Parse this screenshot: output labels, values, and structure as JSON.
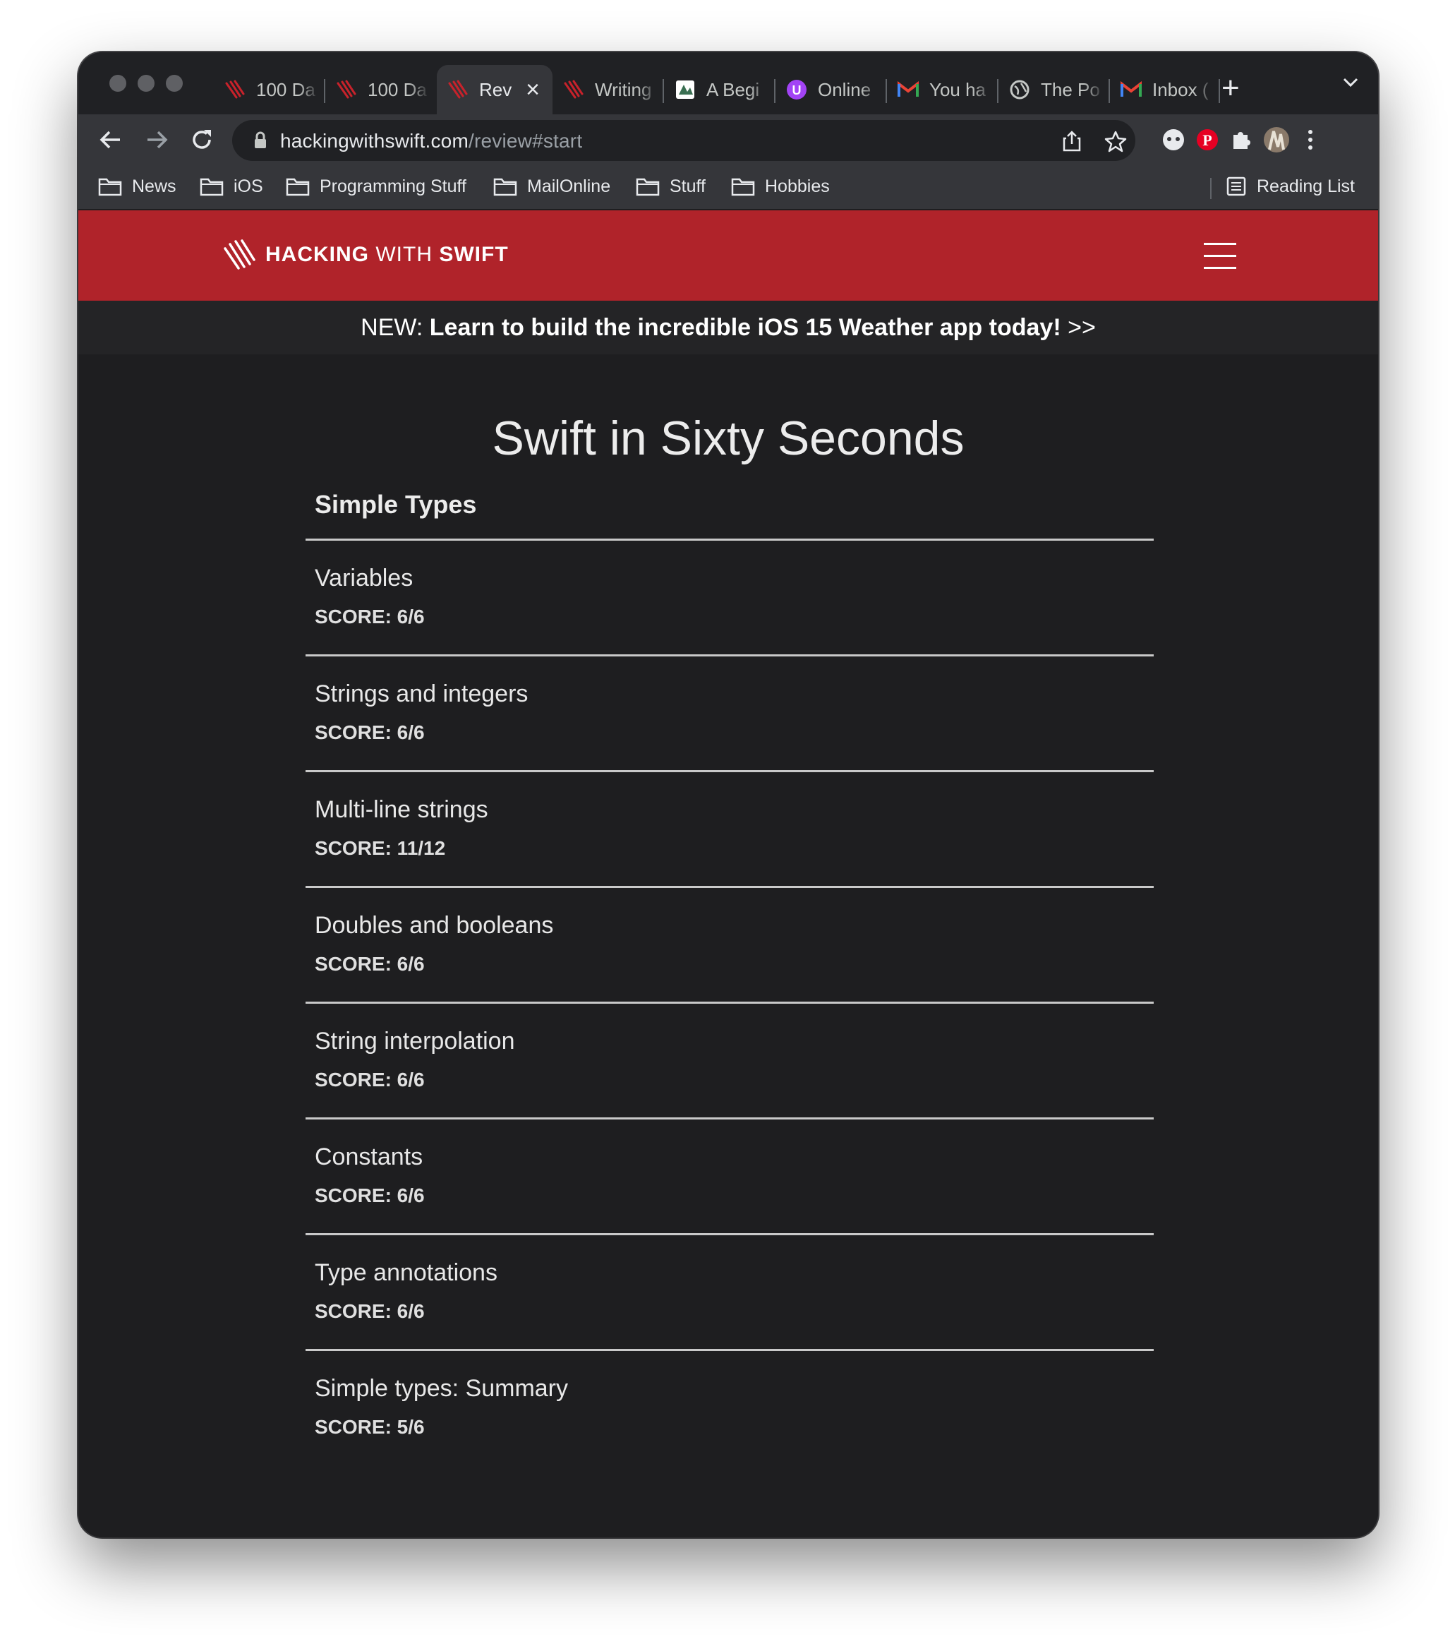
{
  "browser": {
    "tabs": [
      {
        "title": "100 Da",
        "icon": "hws-favicon"
      },
      {
        "title": "100 Da",
        "icon": "hws-favicon"
      },
      {
        "title": "Rev",
        "icon": "hws-favicon",
        "active": true
      },
      {
        "title": "Writing",
        "icon": "hws-favicon"
      },
      {
        "title": "A Begi",
        "icon": "image-favicon"
      },
      {
        "title": "Online",
        "icon": "purple-u-favicon"
      },
      {
        "title": "You ha",
        "icon": "gmail-favicon"
      },
      {
        "title": "The Po",
        "icon": "globe-favicon"
      },
      {
        "title": "Inbox (",
        "icon": "gmail-favicon"
      }
    ],
    "new_tab_label": "+",
    "url_host": "hackingwithswift.com",
    "url_path": "/review#start",
    "bookmarks": [
      "News",
      "iOS",
      "Programming Stuff",
      "MailOnline",
      "Stuff",
      "Hobbies"
    ],
    "reading_list_label": "Reading List"
  },
  "site": {
    "logo_bold1": "HACKING",
    "logo_light": "WITH",
    "logo_bold2": "SWIFT",
    "brand_color": "#b0232a",
    "promo_prefix": "NEW: ",
    "promo_bold": "Learn to build the incredible iOS 15 Weather app today!",
    "promo_suffix": " >>"
  },
  "main": {
    "title": "Swift in Sixty Seconds",
    "section": "Simple Types",
    "items": [
      {
        "name": "Variables",
        "score": "SCORE: 6/6"
      },
      {
        "name": "Strings and integers",
        "score": "SCORE: 6/6"
      },
      {
        "name": "Multi-line strings",
        "score": "SCORE: 11/12"
      },
      {
        "name": "Doubles and booleans",
        "score": "SCORE: 6/6"
      },
      {
        "name": "String interpolation",
        "score": "SCORE: 6/6"
      },
      {
        "name": "Constants",
        "score": "SCORE: 6/6"
      },
      {
        "name": "Type annotations",
        "score": "SCORE: 6/6"
      },
      {
        "name": "Simple types: Summary",
        "score": "SCORE: 5/6"
      }
    ]
  }
}
